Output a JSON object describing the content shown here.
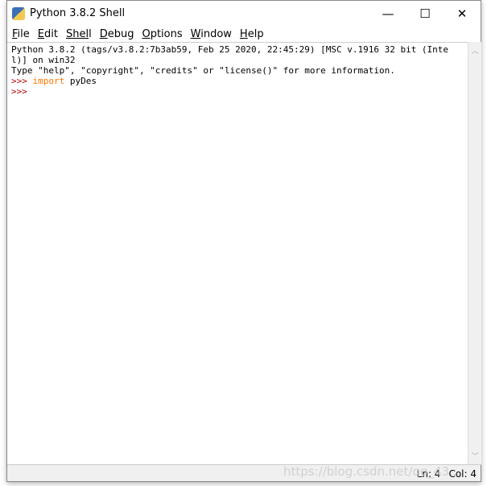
{
  "window": {
    "title": "Python 3.8.2 Shell",
    "minimize": "—",
    "maximize": "☐",
    "close": "✕"
  },
  "menu": [
    {
      "label": "File",
      "key": "F",
      "rest": "ile"
    },
    {
      "label": "Edit",
      "key": "E",
      "rest": "dit"
    },
    {
      "label": "Shell",
      "key": "Shel",
      "rest": "l"
    },
    {
      "label": "Debug",
      "key": "D",
      "rest": "ebug"
    },
    {
      "label": "Options",
      "key": "O",
      "rest": "ptions"
    },
    {
      "label": "Window",
      "key": "W",
      "rest": "indow"
    },
    {
      "label": "Help",
      "key": "H",
      "rest": "elp"
    }
  ],
  "shell": {
    "banner1": "Python 3.8.2 (tags/v3.8.2:7b3ab59, Feb 25 2020, 22:45:29) [MSC v.1916 32 bit (Intel)] on win32",
    "banner2": "Type \"help\", \"copyright\", \"credits\" or \"license()\" for more information.",
    "prompt": ">>> ",
    "keyword": "import",
    "module": " pyDes"
  },
  "status": {
    "line": "Ln: 4",
    "col": "Col: 4"
  },
  "watermark": "https://blog.csdn.net/qq_43...",
  "colors": {
    "prompt": "#c00000",
    "keyword": "#ff7700"
  }
}
